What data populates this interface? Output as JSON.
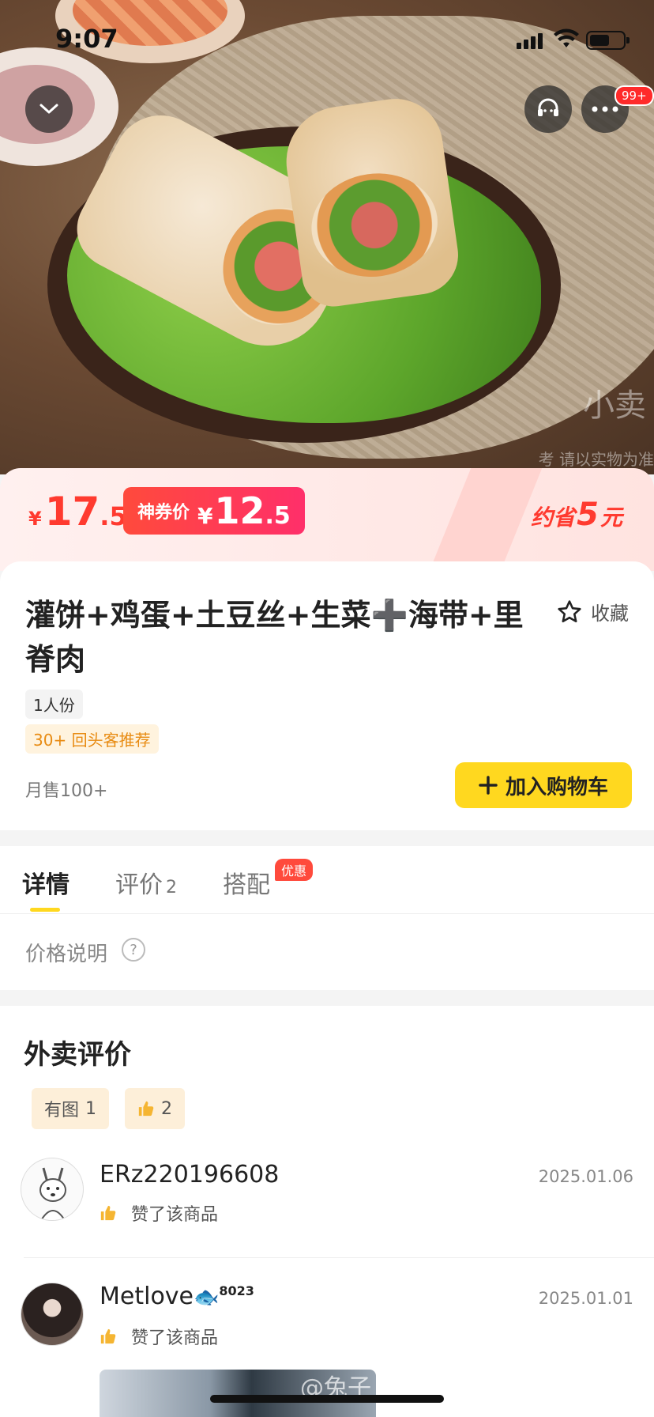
{
  "status_bar": {
    "time": "9:07"
  },
  "hero": {
    "watermark": "小卖",
    "watermark_note": "考 请以实物为准"
  },
  "header": {
    "more_badge": "99+"
  },
  "price": {
    "original_currency": "¥",
    "original_int": "17",
    "original_dec": ".5",
    "coupon_label": "神券价",
    "coupon_currency": "¥",
    "coupon_int": "12",
    "coupon_dec": ".5",
    "save_prefix": "约省",
    "save_amount": "5",
    "save_suffix": "元"
  },
  "product": {
    "title": "灌饼+鸡蛋+土豆丝+生菜➕海带+里脊肉",
    "favorite_label": "收藏",
    "portion_tag": "1人份",
    "return_tag": "30+ 回头客推荐",
    "monthly_sales": "月售100+",
    "add_to_cart": "加入购物车"
  },
  "tabs": [
    {
      "label": "详情",
      "count": ""
    },
    {
      "label": "评价",
      "count": "2"
    },
    {
      "label": "搭配",
      "badge": "优惠"
    }
  ],
  "price_info": {
    "label": "价格说明",
    "icon": "?"
  },
  "reviews": {
    "title": "外卖评价",
    "filters": [
      {
        "label": "有图",
        "count": "1"
      },
      {
        "label": "",
        "count": "2"
      }
    ],
    "items": [
      {
        "user": "ERz220196608",
        "date": "2025.01.06",
        "text": "赞了该商品"
      },
      {
        "user": "Metlove",
        "user_suffix": "8023",
        "date": "2025.01.01",
        "text": "赞了该商品"
      }
    ],
    "bottom_watermark": "@兔子"
  }
}
